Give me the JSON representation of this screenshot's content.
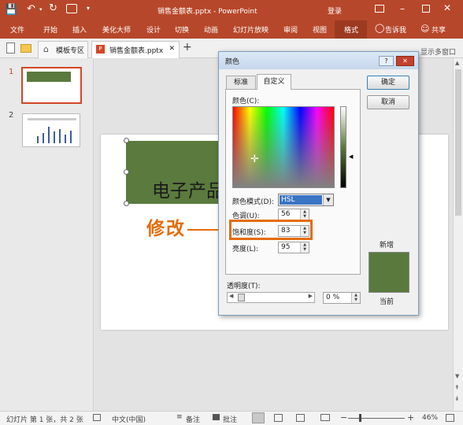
{
  "titlebar": {
    "document_title": "销售金额表.pptx - PowerPoint",
    "login": "登录"
  },
  "ribbon": {
    "tabs": [
      "文件",
      "开始",
      "插入",
      "美化大师",
      "设计",
      "切换",
      "动画",
      "幻灯片放映",
      "审阅",
      "视图",
      "格式"
    ],
    "tell_me": "告诉我",
    "share": "共享"
  },
  "tabstrip": {
    "template_tab": "模板专区",
    "file_tab": "销售金额表.pptx",
    "add": "+",
    "show_multi": "显示多窗口"
  },
  "thumbnails": [
    {
      "number": "1"
    },
    {
      "number": "2"
    }
  ],
  "slide": {
    "text": "电子产品"
  },
  "annotation": {
    "label": "修改"
  },
  "dialog": {
    "title": "颜色",
    "help": "?",
    "close": "✕",
    "tabs": {
      "standard": "标准",
      "custom": "自定义"
    },
    "colors_label": "颜色(C):",
    "color_model_label": "颜色模式(D):",
    "color_model_value": "HSL",
    "hue_label": "色调(U):",
    "hue_value": "56",
    "saturation_label": "饱和度(S):",
    "saturation_value": "83",
    "lightness_label": "亮度(L):",
    "lightness_value": "95",
    "ok": "确定",
    "cancel": "取消",
    "new_label": "新增",
    "current_label": "当前",
    "new_color": "#5a7a3d",
    "current_color": "#5a7a3d",
    "transparency_label": "透明度(T):",
    "transparency_value": "0 %"
  },
  "status": {
    "slide_info": "幻灯片 第 1 张，共 2 张",
    "language": "中文(中国)",
    "notes": "备注",
    "comments": "批注",
    "zoom_minus": "−",
    "zoom_plus": "+",
    "zoom": "46%"
  },
  "colors": {
    "accent": "#b7472a",
    "shape_fill": "#5b7a3e",
    "annotation": "#e46c0a"
  }
}
